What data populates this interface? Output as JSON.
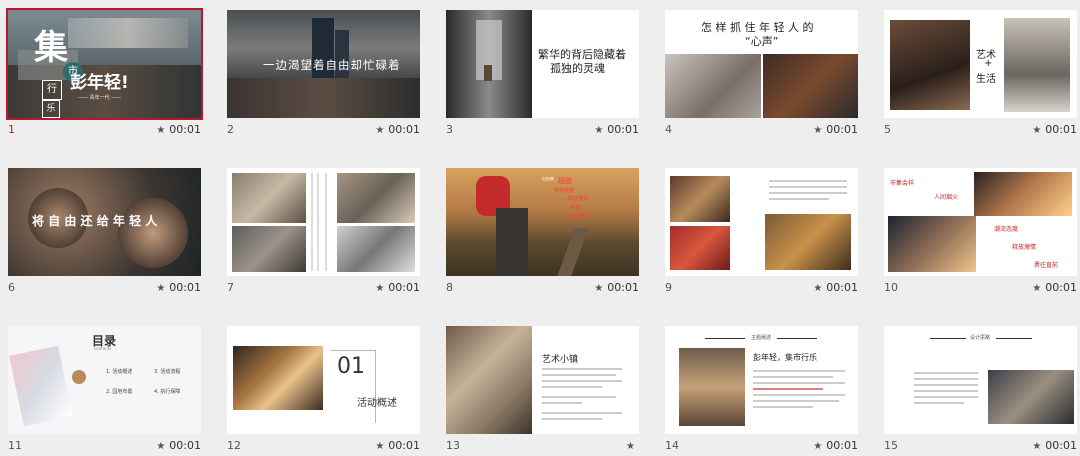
{
  "slides": [
    {
      "number": "1",
      "duration": "00:01",
      "texts": {
        "big": "集",
        "c1": "市",
        "c2": "行",
        "c3": "乐",
        "main": "彭年轻!",
        "sub": "—— 青年一代 ——"
      }
    },
    {
      "number": "2",
      "duration": "00:01",
      "texts": {
        "main": "一边渴望着自由却忙碌着"
      }
    },
    {
      "number": "3",
      "duration": "00:01",
      "texts": {
        "line1": "繁华的背后隐藏着",
        "line2": "孤独的灵魂"
      }
    },
    {
      "number": "4",
      "duration": "00:01",
      "texts": {
        "line1": "怎 样 抓 住 年 轻 人 的",
        "line2": "“心声”"
      }
    },
    {
      "number": "5",
      "duration": "00:01",
      "texts": {
        "a": "艺术",
        "b": "+",
        "c": "生活"
      }
    },
    {
      "number": "6",
      "duration": "00:01",
      "texts": {
        "main": "将 自 由 还 给 年 轻 人"
      }
    },
    {
      "number": "7",
      "duration": "00:01",
      "texts": {}
    },
    {
      "number": "8",
      "duration": "00:01",
      "texts": {
        "a": "自由来",
        "b": "摆脱",
        "c": "轻松愉悦",
        "d": "释放真我",
        "e": "青春",
        "f": "生活的热爱"
      }
    },
    {
      "number": "9",
      "duration": "00:01",
      "texts": {}
    },
    {
      "number": "10",
      "duration": "00:01",
      "texts": {
        "a": "市集会样",
        "b": "人间烟火",
        "c": "潮流态度",
        "d": "释放激情",
        "e": "勇往直前"
      }
    },
    {
      "number": "11",
      "duration": "00:01",
      "texts": {
        "title": "目录",
        "sub": "contents",
        "i1": "1. 活动概述",
        "i2": "3. 活动流程",
        "i3": "2. 园地布置",
        "i4": "4. 执行保障"
      }
    },
    {
      "number": "12",
      "duration": "00:01",
      "texts": {
        "num": "01",
        "label": "活动概述"
      }
    },
    {
      "number": "13",
      "duration": "",
      "texts": {
        "title": "艺术小镇"
      }
    },
    {
      "number": "14",
      "duration": "00:01",
      "texts": {
        "head": "主题阐述",
        "main": "彭年轻，集市行乐"
      }
    },
    {
      "number": "15",
      "duration": "00:01",
      "texts": {
        "head": "设计思路"
      }
    }
  ],
  "colors": {
    "selection": "#b8182d",
    "accent_red": "#c0282d"
  },
  "icons": {
    "star": "star-icon"
  }
}
